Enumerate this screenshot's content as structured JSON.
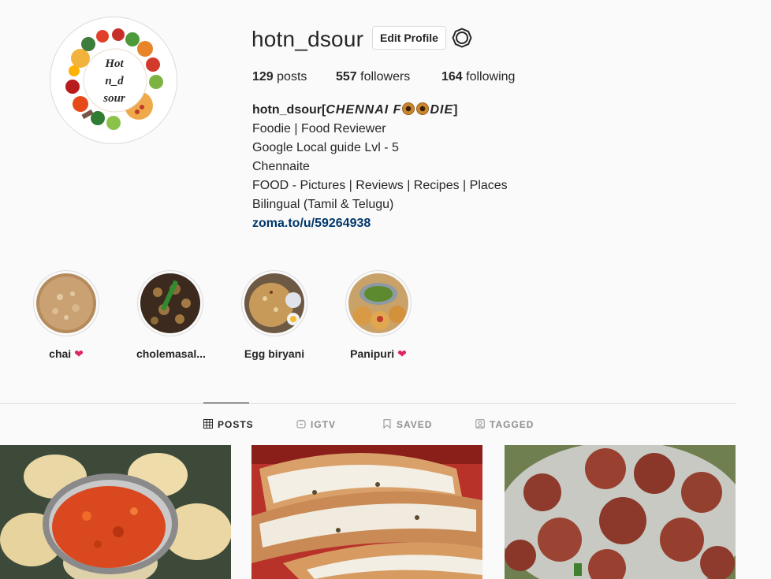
{
  "profile": {
    "username": "hotn_dsour",
    "edit_label": "Edit Profile",
    "avatar_text": [
      "Hot",
      "n_d",
      "sour"
    ]
  },
  "stats": {
    "posts_count": "129",
    "posts_label": "posts",
    "followers_count": "557",
    "followers_label": "followers",
    "following_count": "164",
    "following_label": "following"
  },
  "bio": {
    "name_prefix": "hotn_dsour[",
    "name_styled_1": "CHENNAI F",
    "name_styled_2": "DIE",
    "name_suffix": "]",
    "lines": [
      "Foodie | Food Reviewer",
      "Google Local guide Lvl - 5",
      "Chennaite",
      "FOOD - Pictures | Reviews | Recipes | Places",
      "Bilingual (Tamil & Telugu)"
    ],
    "link": "zoma.to/u/59264938"
  },
  "highlights": [
    {
      "label": "chai",
      "heart": "❤"
    },
    {
      "label": "cholemasal...",
      "heart": ""
    },
    {
      "label": "Egg biryani",
      "heart": ""
    },
    {
      "label": "Panipuri",
      "heart": "❤"
    }
  ],
  "tabs": [
    {
      "label": "POSTS",
      "icon": "grid-icon"
    },
    {
      "label": "IGTV",
      "icon": "igtv-icon"
    },
    {
      "label": "SAVED",
      "icon": "bookmark-icon"
    },
    {
      "label": "TAGGED",
      "icon": "tagged-icon"
    }
  ],
  "colors": {
    "background": "#fafafa",
    "text": "#262626",
    "secondary": "#8e8e8e",
    "link": "#00376b",
    "border": "#dbdbdb"
  }
}
